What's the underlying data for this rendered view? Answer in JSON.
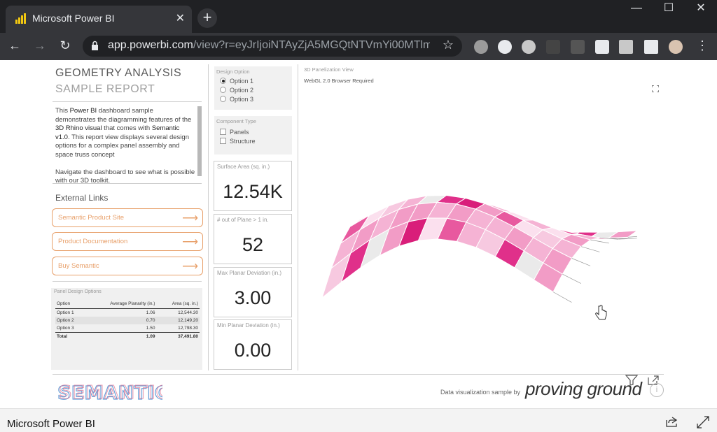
{
  "browser": {
    "tab_title": "Microsoft Power BI",
    "url_host": "app.powerbi.com",
    "url_path": "/view?r=eyJrIjoiNTAyZjA5MGQtNTVmYi00MTlm...",
    "icons": [
      "back-icon",
      "forward-icon",
      "reload-icon",
      "lock-icon",
      "star-icon",
      "extensions-icon",
      "menu-icon"
    ]
  },
  "report": {
    "title": "GEOMETRY ANALYSIS",
    "subtitle": "SAMPLE REPORT",
    "desc_p1_a": "This ",
    "desc_p1_b": "Power BI",
    "desc_p1_c": " dashboard sample demonstrates the diagramming features of the ",
    "desc_p1_d": "3D Rhino visual",
    "desc_p1_e": " that comes with ",
    "desc_p1_f": "Semantic v1.0",
    "desc_p1_g": ". This report view displays several design options for a complex panel assembly and space truss concept",
    "desc_p2": "Navigate the dashboard to see what is possible with our 3D toolkit.",
    "external_links_heading": "External Links",
    "links": [
      {
        "label": "Semantic Product Site"
      },
      {
        "label": "Product Documentation"
      },
      {
        "label": "Buy Semantic"
      }
    ],
    "table": {
      "heading": "Panel Design Options",
      "columns": [
        "Option",
        "Average Planarity (in.)",
        "Area (sq. in.)"
      ],
      "rows": [
        [
          "Option 1",
          "1.06",
          "12,544.30"
        ],
        [
          "Option 2",
          "0.70",
          "12,149.20"
        ],
        [
          "Option 3",
          "1.50",
          "12,798.30"
        ]
      ],
      "total": [
        "Total",
        "1.09",
        "37,491.80"
      ]
    },
    "design_option": {
      "heading": "Design Option",
      "options": [
        "Option 1",
        "Option 2",
        "Option 3"
      ],
      "selected": "Option 1"
    },
    "component_type": {
      "heading": "Component Type",
      "options": [
        "Panels",
        "Structure"
      ]
    },
    "cards": [
      {
        "label": "Surface Area (sq. in.)",
        "value": "12.54K"
      },
      {
        "label": "# out of Plane > 1 in.",
        "value": "52"
      },
      {
        "label": "Max Planar Deviation (in.)",
        "value": "3.00"
      },
      {
        "label": "Min Planar Deviation (in.)",
        "value": "0.00"
      }
    ],
    "viz": {
      "heading": "3D Panelization View",
      "subtext": "WebGL 2.0 Browser Required"
    },
    "footer_logo": "SEMANTIC",
    "footer_credit": "Data visualization sample by",
    "footer_brand": "proving ground"
  },
  "app": {
    "title": "Microsoft Power BI"
  },
  "colors": {
    "accent": "#e8a06a",
    "panel_pink": "#e0308a",
    "chrome_dark": "#202124"
  }
}
